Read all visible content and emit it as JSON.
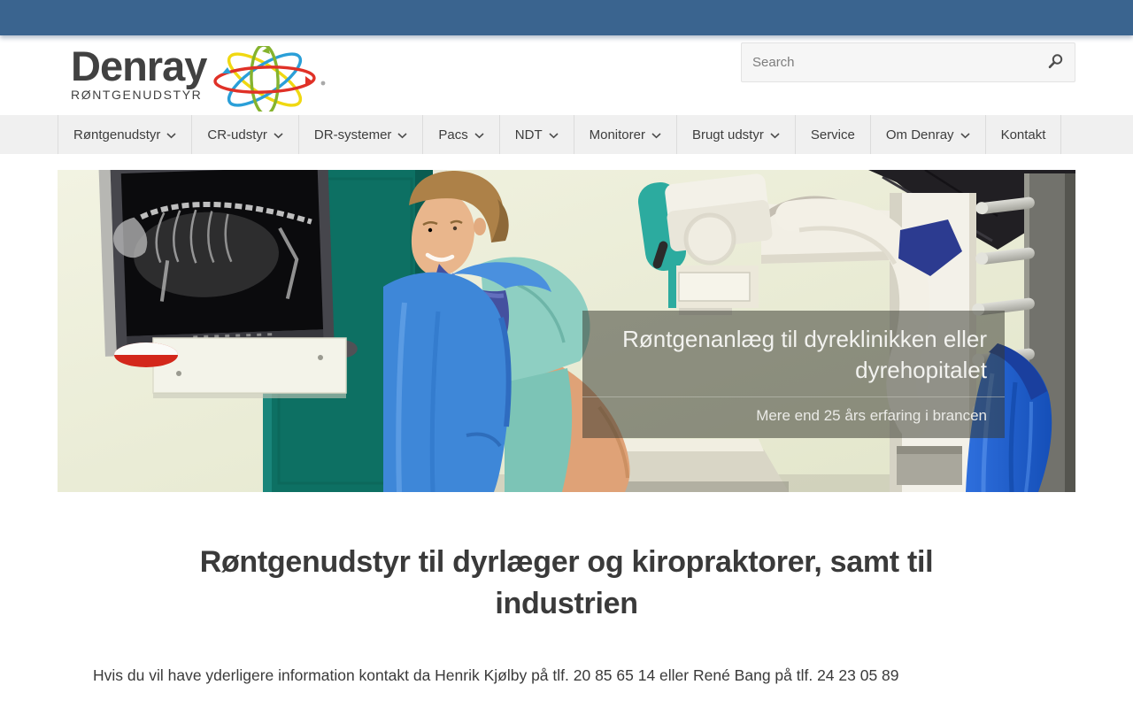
{
  "header": {
    "logo": {
      "name": "Denray",
      "tagline": "RØNTGENUDSTYR"
    },
    "search": {
      "placeholder": "Search"
    }
  },
  "nav": {
    "items": [
      {
        "label": "Røntgenudstyr",
        "has_dropdown": true
      },
      {
        "label": "CR-udstyr",
        "has_dropdown": true
      },
      {
        "label": "DR-systemer",
        "has_dropdown": true
      },
      {
        "label": "Pacs",
        "has_dropdown": true
      },
      {
        "label": "NDT",
        "has_dropdown": true
      },
      {
        "label": "Monitorer",
        "has_dropdown": true
      },
      {
        "label": "Brugt udstyr",
        "has_dropdown": true
      },
      {
        "label": "Service",
        "has_dropdown": false
      },
      {
        "label": "Om Denray",
        "has_dropdown": true
      },
      {
        "label": "Kontakt",
        "has_dropdown": false
      }
    ]
  },
  "hero": {
    "title": "Røntgenanlæg til dyreklinikken eller\ndyrehopitalet",
    "subtitle": "Mere end 25 års erfaring i brancen",
    "image_description": "Veterinarian in blue lead apron beside wall monitor showing animal x-ray and mobile x-ray machine"
  },
  "content": {
    "heading": "Røntgenudstyr til dyrlæger og kiropraktorer, samt til\nindustrien",
    "paragraph": "Hvis du vil have yderligere information kontakt da Henrik Kjølby på tlf. 20 85 65 14 eller René Bang på tlf. 24 23 05 89"
  },
  "icons": {
    "search": "search-icon",
    "chevron": "chevron-down-icon",
    "logo_atom": "atom-icon"
  },
  "colors": {
    "topbar_blue": "#3a648f",
    "nav_background": "#f0f0f0",
    "logo_red": "#e03127",
    "logo_blue": "#2a9fd8",
    "logo_yellow": "#f0d811",
    "logo_green": "#85b32e",
    "hero_door_teal": "#0d7063",
    "hero_apron_blue": "#1c5ed2",
    "overlay": "rgba(56,58,48,0.52)"
  }
}
